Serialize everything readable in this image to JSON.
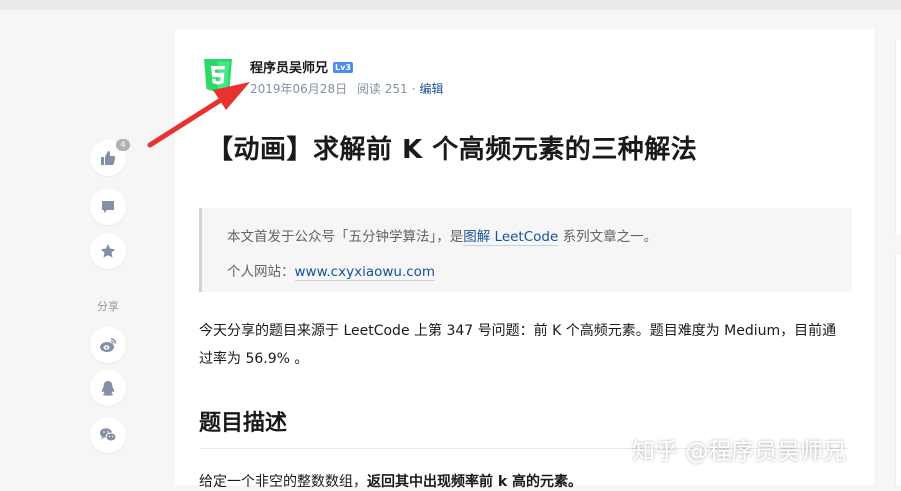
{
  "article": {
    "author_name": "程序员吴师兄",
    "author_level": "Lv3",
    "date": "2019年06月28日",
    "reads": "阅读 251",
    "separator": "·",
    "edit_label": "编辑",
    "title": "【动画】求解前 K 个高频元素的三种解法",
    "quote": {
      "line1_prefix": "本文首发于公众号「五分钟学算法」，是",
      "line1_link": "图解 LeetCode",
      "line1_suffix": " 系列文章之一。",
      "line2_prefix": "个人网站：",
      "line2_link": "www.cxyxiaowu.com"
    },
    "intro": "今天分享的题目来源于 LeetCode 上第 347 号问题：前 K 个高频元素。题目难度为 Medium，目前通过率为 56.9% 。",
    "section_heading": "题目描述",
    "cut_text_normal": "给定一个非空的整数数组，",
    "cut_text_bold": "返回其中出现频率前 k 高的元素。"
  },
  "sidebar": {
    "like_count": "4",
    "share_label": "分享"
  },
  "watermark": "知乎 @程序员吴师兄",
  "colors": {
    "link": "#175199",
    "meta": "#8590a6",
    "arrow": "#e8322f",
    "logo": "#2bd96b",
    "level_badge": "#4a8cf0"
  },
  "icons": {
    "logo": "html5-logo-icon",
    "like": "thumbs-up-icon",
    "comment": "comment-icon",
    "favorite": "star-icon",
    "weibo": "weibo-icon",
    "qq": "qq-icon",
    "wechat": "wechat-icon"
  }
}
